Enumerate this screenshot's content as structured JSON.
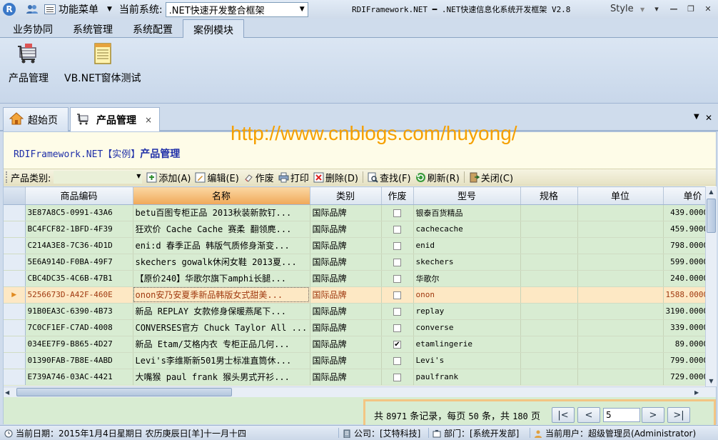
{
  "titlebar": {
    "app_icon_letter": "R",
    "function_menu_label": "功能菜单",
    "current_system_label": "当前系统:",
    "current_system_value": ".NET快速开发整合框架",
    "window_title": "RDIFramework.NET ━ .NET快速信息化系统开发框架 V2.8",
    "style_label": "Style"
  },
  "ribbon": {
    "tabs": [
      "业务协同",
      "系统管理",
      "系统配置",
      "案例模块"
    ],
    "active_tab": "案例模块",
    "buttons": [
      {
        "label": "产品管理",
        "icon": "cart-icon"
      },
      {
        "label": "VB.NET窗体测试",
        "icon": "notepad-icon"
      }
    ]
  },
  "doc_tabs": {
    "home_label": "超始页",
    "current_label": "产品管理",
    "close_glyph": "×"
  },
  "page": {
    "watermark": "http://www.cnblogs.com/huyong/",
    "title_prefix": "RDIFramework.NET【实例】",
    "title_main": "产品管理"
  },
  "toolbar": {
    "category_label": "产品类别:",
    "buttons": [
      {
        "label": "添加(A)",
        "icon": "add-icon"
      },
      {
        "label": "编辑(E)",
        "icon": "edit-icon"
      },
      {
        "label": "作废",
        "icon": "eraser-icon"
      },
      {
        "label": "打印",
        "icon": "print-icon"
      },
      {
        "label": "删除(D)",
        "icon": "delete-icon"
      },
      {
        "label": "查找(F)",
        "icon": "find-icon"
      },
      {
        "label": "刷新(R)",
        "icon": "refresh-icon"
      },
      {
        "label": "关闭(C)",
        "icon": "close-form-icon"
      }
    ]
  },
  "grid": {
    "columns": [
      "商品编码",
      "名称",
      "类别",
      "作废",
      "型号",
      "规格",
      "单位",
      "单价"
    ],
    "sorted_column": "名称",
    "rows": [
      {
        "code": "3E87A8C5-0991-43A6",
        "name": "betu百图专柜正品 2013秋装新款钉...",
        "category": "国际品牌",
        "void": false,
        "model": "银泰百货精品",
        "spec": "",
        "unit": "",
        "price": "439.0000"
      },
      {
        "code": "BC4FCF82-1BFD-4F39",
        "name": "狂欢价 Cache Cache 赛柔 翻领麂...",
        "category": "国际品牌",
        "void": false,
        "model": "cachecache",
        "spec": "",
        "unit": "",
        "price": "459.9000"
      },
      {
        "code": "C214A3E8-7C36-4D1D",
        "name": "eni:d 春季正品 韩版气质修身渐变...",
        "category": "国际品牌",
        "void": false,
        "model": "enid",
        "spec": "",
        "unit": "",
        "price": "798.0000"
      },
      {
        "code": "5E6A914D-F0BA-49F7",
        "name": "skechers gowalk休闲女鞋 2013夏...",
        "category": "国际品牌",
        "void": false,
        "model": "skechers",
        "spec": "",
        "unit": "",
        "price": "599.0000"
      },
      {
        "code": "CBC4DC35-4C6B-47B1",
        "name": "【原价240】华歌尔旗下amphi长腿...",
        "category": "国际品牌",
        "void": false,
        "model": "华歌尔",
        "spec": "",
        "unit": "",
        "price": "240.0000"
      },
      {
        "code": "5256673D-A42F-460E",
        "name": "onon安乃安夏季新品韩版女式甜美...",
        "category": "国际品牌",
        "void": false,
        "model": "onon",
        "spec": "",
        "unit": "",
        "price": "1588.0000"
      },
      {
        "code": "91B0EA3C-6390-4B73",
        "name": "新品 REPLAY 女款修身保暖燕尾下...",
        "category": "国际品牌",
        "void": false,
        "model": "replay",
        "spec": "",
        "unit": "",
        "price": "3190.0000"
      },
      {
        "code": "7C0CF1EF-C7AD-4008",
        "name": "CONVERSES官方 Chuck Taylor All ...",
        "category": "国际品牌",
        "void": false,
        "model": "converse",
        "spec": "",
        "unit": "",
        "price": "339.0000"
      },
      {
        "code": "034EE7F9-B865-4D27",
        "name": "新品 Etam/艾格内衣 专柜正品几何...",
        "category": "国际品牌",
        "void": true,
        "model": "etamlingerie",
        "spec": "",
        "unit": "",
        "price": "89.0000"
      },
      {
        "code": "01390FAB-7B8E-4ABD",
        "name": "Levi's李维斯新501男士标准直筒休...",
        "category": "国际品牌",
        "void": false,
        "model": "Levi's",
        "spec": "",
        "unit": "",
        "price": "799.0000"
      },
      {
        "code": "E739A746-03AC-4421",
        "name": "大嘴猴 paul frank 猴头男式开衫...",
        "category": "国际品牌",
        "void": false,
        "model": "paulfrank",
        "spec": "",
        "unit": "",
        "price": "729.0000"
      }
    ],
    "selected_row_index": 5,
    "selected_marker": "▶"
  },
  "pager": {
    "total_prefix": "共",
    "total": "8971",
    "total_suffix": "条记录，每页",
    "page_size": "50",
    "page_size_suffix": "条，共",
    "pages": "180",
    "pages_suffix": "页",
    "current_page": "5",
    "first_glyph": "|<",
    "prev_glyph": "<",
    "next_glyph": ">",
    "last_glyph": ">|"
  },
  "statusbar": {
    "date": "当前日期：2015年1月4日星期日 农历庚辰日[羊]十一月十四",
    "company": "公司：[艾特科技]",
    "department": "部门：[系统开发部]",
    "user": "当前用户：超级管理员(Administrator)"
  },
  "colors": {
    "grid_row": "#d8ecd2",
    "selected_row": "#fde8c4",
    "selected_text": "#a03a10",
    "title_blue": "#1f2fa8",
    "watermark": "#f5a000",
    "pager_border": "#f3c583"
  }
}
